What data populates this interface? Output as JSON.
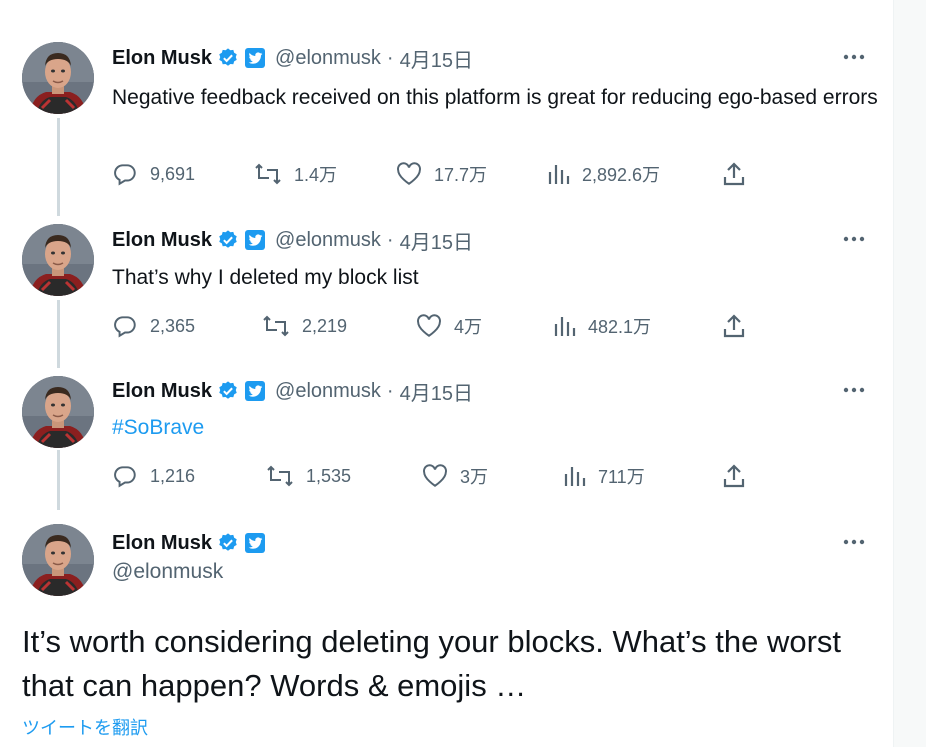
{
  "author": {
    "name": "Elon Musk",
    "handle": "@elonmusk"
  },
  "icons": {
    "verified": "verified-badge-icon",
    "twitter": "twitter-bird-icon",
    "more": "more-dots-icon",
    "reply": "reply-icon",
    "retweet": "retweet-icon",
    "like": "heart-icon",
    "views": "views-chart-icon",
    "share": "share-icon"
  },
  "colors": {
    "accent": "#1d9bf0",
    "text": "#0f1419",
    "secondary": "#536471",
    "thread_line": "#cfd9de"
  },
  "tweets": [
    {
      "date": "4月15日",
      "text": "Negative feedback received on this platform is great for reducing ego-based errors",
      "replies": "9,691",
      "retweets": "1.4万",
      "likes": "17.7万",
      "views": "2,892.6万"
    },
    {
      "date": "4月15日",
      "text": "That’s why I deleted my block list",
      "replies": "2,365",
      "retweets": "2,219",
      "likes": "4万",
      "views": "482.1万"
    },
    {
      "date": "4月15日",
      "text": "#SoBrave",
      "replies": "1,216",
      "retweets": "1,535",
      "likes": "3万",
      "views": "711万"
    }
  ],
  "main_tweet": {
    "text": "It’s worth considering deleting your blocks. What’s the worst that can happen? Words & emojis …",
    "translate_label": "ツイートを翻訳"
  }
}
